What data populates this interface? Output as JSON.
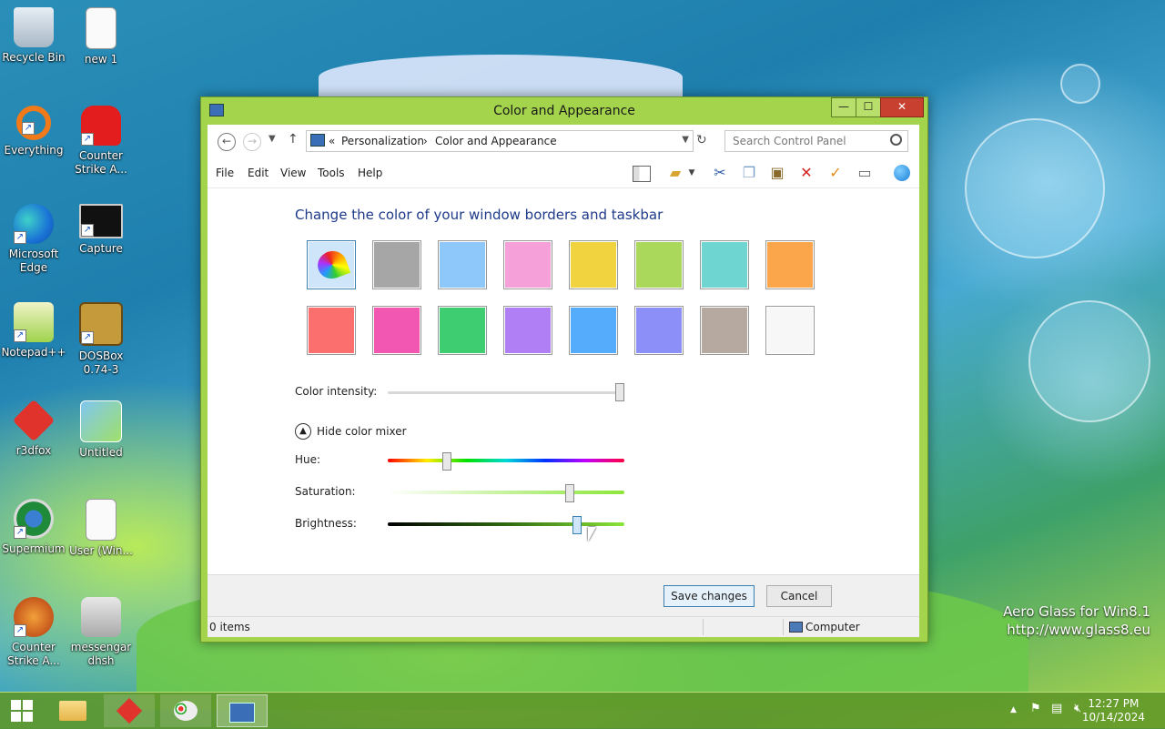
{
  "desktop": {
    "icons": [
      {
        "label": "Recycle Bin",
        "icon": "recycle-bin-icon"
      },
      {
        "label": "new 1",
        "icon": "text-file-icon"
      },
      {
        "label": "Everything",
        "icon": "search-app-icon"
      },
      {
        "label": "Counter Strike A...",
        "icon": "game-icon"
      },
      {
        "label": "Microsoft Edge",
        "icon": "edge-browser-icon"
      },
      {
        "label": "Capture",
        "icon": "capture-icon"
      },
      {
        "label": "Notepad++",
        "icon": "notepad-plus-icon"
      },
      {
        "label": "DOSBox 0.74-3",
        "icon": "dosbox-icon"
      },
      {
        "label": "r3dfox",
        "icon": "browser-icon"
      },
      {
        "label": "Untitled",
        "icon": "image-file-icon"
      },
      {
        "label": "Supermium",
        "icon": "browser-icon"
      },
      {
        "label": "User (Win...",
        "icon": "image-file-icon"
      },
      {
        "label": "Counter Strike A...",
        "icon": "game-icon"
      },
      {
        "label": "messengar dhsh",
        "icon": "user-icon"
      }
    ],
    "watermark": {
      "line1": "Aero Glass for Win8.1",
      "line2": "http://www.glass8.eu"
    }
  },
  "window": {
    "title": "Color and Appearance",
    "buttons": {
      "minimize": "—",
      "maximize": "☐",
      "close": "✕"
    },
    "address": {
      "prefix": "«",
      "crumb1": "Personalization",
      "separator": "›",
      "crumb2": "Color and Appearance"
    },
    "search_placeholder": "Search Control Panel",
    "menu": [
      "File",
      "Edit",
      "View",
      "Tools",
      "Help"
    ],
    "heading": "Change the color of your window borders and taskbar",
    "swatch_colors": [
      "#a9d4f5",
      "#a6a6a6",
      "#8ec8fb",
      "#f5a0d8",
      "#f1d340",
      "#a9d85a",
      "#6fd5d0",
      "#fca64c",
      "#fb6f6f",
      "#f257b2",
      "#3fcd72",
      "#b07ff5",
      "#55acfc",
      "#8c8ff8",
      "#b6aaa0",
      "#f7f7f7"
    ],
    "intensity": {
      "label": "Color intensity:",
      "value": 1.0
    },
    "mixer_toggle": "Hide color mixer",
    "hue": {
      "label": "Hue:",
      "value": 0.24
    },
    "saturation": {
      "label": "Saturation:",
      "value": 0.78
    },
    "brightness": {
      "label": "Brightness:",
      "value": 0.81
    },
    "save_label": "Save changes",
    "cancel_label": "Cancel",
    "status_items": "0 items",
    "status_computer": "Computer"
  },
  "taskbar": {
    "clock_time": "12:27 PM",
    "clock_date": "10/14/2024"
  }
}
